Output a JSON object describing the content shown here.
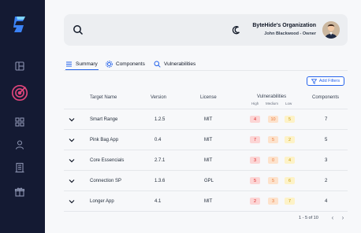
{
  "header": {
    "org_name": "ByteHide's Organization",
    "user_line": "John Blackwood - Owner"
  },
  "tabs": [
    {
      "label": "Summary",
      "active": true
    },
    {
      "label": "Components",
      "active": false
    },
    {
      "label": "Vulnerabilities",
      "active": false
    }
  ],
  "filter_button": "Add Filters",
  "columns": {
    "target": "Target Name",
    "version": "Version",
    "license": "License",
    "vulnerabilities": "Vulnerabilities",
    "vuln_high": "High",
    "vuln_medium": "Medium",
    "vuln_low": "Low",
    "components": "Components"
  },
  "rows": [
    {
      "name": "Smart Range",
      "version": "1.2.5",
      "license": "MIT",
      "high": "4",
      "medium": "10",
      "low": "5",
      "components": "7"
    },
    {
      "name": "Pink Bag App",
      "version": "0.4",
      "license": "MIT",
      "high": "7",
      "medium": "5",
      "low": "2",
      "components": "5"
    },
    {
      "name": "Core Essencials",
      "version": "2.7.1",
      "license": "MIT",
      "high": "3",
      "medium": "0",
      "low": "4",
      "components": "3"
    },
    {
      "name": "Connection SP",
      "version": "1.3.6",
      "license": "GPL",
      "high": "5",
      "medium": "5",
      "low": "6",
      "components": "2"
    },
    {
      "name": "Longer App",
      "version": "4.1",
      "license": "MIT",
      "high": "2",
      "medium": "3",
      "low": "7",
      "components": "4"
    }
  ],
  "pagination": {
    "range": "1 - 5 of 10"
  },
  "colors": {
    "sidebar": "#141a33",
    "accent": "#2563eb",
    "active_nav": "#e0457b"
  }
}
